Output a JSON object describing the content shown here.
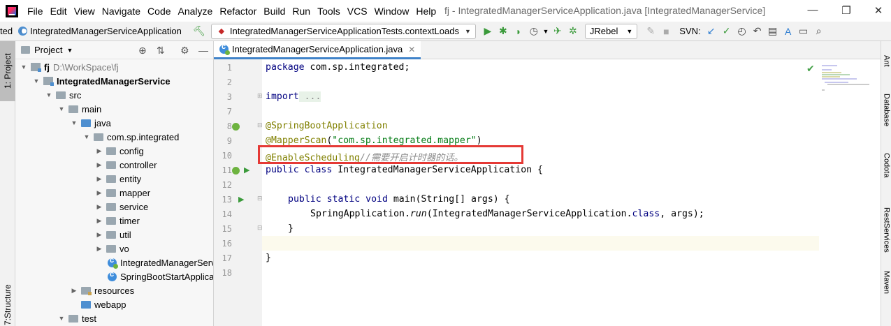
{
  "menu": {
    "items": [
      "File",
      "Edit",
      "View",
      "Navigate",
      "Code",
      "Analyze",
      "Refactor",
      "Build",
      "Run",
      "Tools",
      "VCS",
      "Window",
      "Help"
    ],
    "window_title": "fj - IntegratedManagerServiceApplication.java [IntegratedManagerService]",
    "minimize": "—",
    "restore": "❐",
    "close": "✕"
  },
  "toolbar": {
    "crumb_prefix": "ted",
    "crumb_class": "IntegratedManagerServiceApplication",
    "run_config": "IntegratedManagerServiceApplicationTests.contextLoads",
    "jrebel": "JRebel",
    "svn_label": "SVN:"
  },
  "left_stripe": {
    "project_tab": "1: Project",
    "structure_tab": "Structure",
    "structure_prefix": "7:"
  },
  "project_panel": {
    "title": "Project",
    "tree": [
      {
        "label": "fj",
        "extra": "D:\\WorkSpace\\fj"
      },
      {
        "label": "IntegratedManagerService"
      },
      {
        "label": "src"
      },
      {
        "label": "main"
      },
      {
        "label": "java"
      },
      {
        "label": "com.sp.integrated"
      },
      {
        "label": "config"
      },
      {
        "label": "controller"
      },
      {
        "label": "entity"
      },
      {
        "label": "mapper"
      },
      {
        "label": "service"
      },
      {
        "label": "timer"
      },
      {
        "label": "util"
      },
      {
        "label": "vo"
      },
      {
        "label": "IntegratedManagerServiceApplication"
      },
      {
        "label": "SpringBootStartApplication"
      },
      {
        "label": "resources"
      },
      {
        "label": "webapp"
      },
      {
        "label": "test"
      }
    ]
  },
  "editor": {
    "tab_label": "IntegratedManagerServiceApplication.java",
    "tab_close": "✕",
    "line_numbers": [
      "1",
      "2",
      "3",
      "7",
      "8",
      "9",
      "10",
      "11",
      "12",
      "13",
      "14",
      "15",
      "16",
      "17",
      "18"
    ],
    "code": {
      "l1_kw": "package",
      "l1_rest": " com.sp.integrated;",
      "l3_kw": "import",
      "l3_rest": " ...",
      "l8": "@SpringBootApplication",
      "l9_ann": "@MapperScan",
      "l9_open": "(",
      "l9_str": "\"com.sp.integrated.mapper\"",
      "l9_close": ")",
      "l10_ann": "@EnableScheduling",
      "l10_cmt": "//需要开启计时器的话。",
      "l11_kw": "public class",
      "l11_rest": " IntegratedManagerServiceApplication {",
      "l13_kw": "public static void",
      "l13_rest": " main(String[] args) {",
      "l14_pre": "SpringApplication.",
      "l14_run": "run",
      "l14_mid": "(IntegratedManagerServiceApplication.",
      "l14_kw": "class",
      "l14_end": ", args);",
      "l15": "}",
      "l17": "}"
    }
  },
  "right_stripe": {
    "tabs": [
      "Ant",
      "Database",
      "Codota",
      "RestServices",
      "Maven"
    ]
  },
  "colors": {
    "keyword": "#000080",
    "annotation": "#808000",
    "string": "#067d17",
    "comment": "#8c8c8c",
    "highlight_box": "#e53935"
  }
}
